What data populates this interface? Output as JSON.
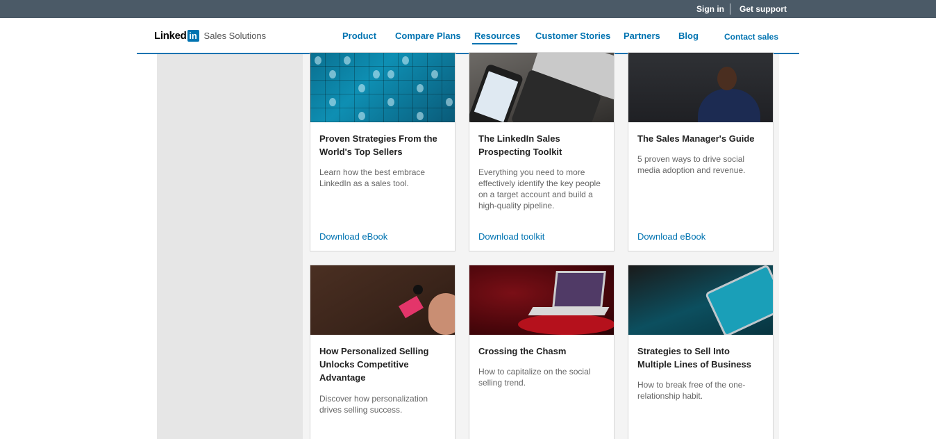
{
  "topbar": {
    "sign_in": "Sign in",
    "get_support": "Get support"
  },
  "header": {
    "logo_word": "Linked",
    "logo_in": "in",
    "logo_sub": "Sales Solutions",
    "nav": [
      "Product",
      "Compare Plans",
      "Resources",
      "Customer Stories",
      "Partners",
      "Blog"
    ],
    "active_nav": "Resources",
    "contact": "Contact sales"
  },
  "cards": [
    {
      "title": "Proven Strategies From the World's Top Sellers",
      "desc": "Learn how the best embrace LinkedIn as a sales tool.",
      "cta": "Download eBook"
    },
    {
      "title": "The LinkedIn Sales Prospecting Toolkit",
      "desc": "Everything you need to more effectively identify the key people on a target account and build a high-quality pipeline.",
      "cta": "Download toolkit"
    },
    {
      "title": "The Sales Manager's Guide",
      "desc": "5 proven ways to drive social media adoption and revenue.",
      "cta": "Download eBook"
    },
    {
      "title": "How Personalized Selling Unlocks Competitive Advantage",
      "desc": "Discover how personalization drives selling success.",
      "cta": ""
    },
    {
      "title": "Crossing the Chasm",
      "desc": "How to capitalize on the social selling trend.",
      "cta": ""
    },
    {
      "title": "Strategies to Sell Into Multiple Lines of Business",
      "desc": "How to break free of the one-relationship habit.",
      "cta": ""
    }
  ]
}
